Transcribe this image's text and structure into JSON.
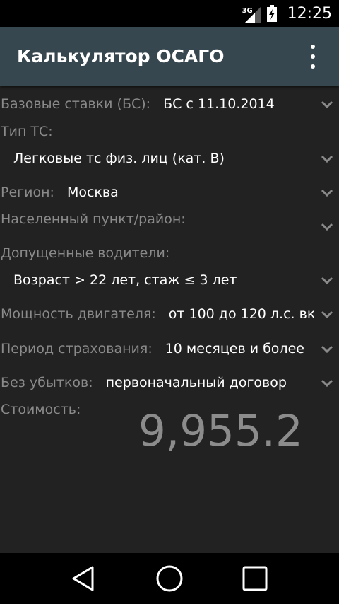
{
  "status_bar": {
    "network": "3G",
    "time": "12:25"
  },
  "app_bar": {
    "title": "Калькулятор ОСАГО",
    "overflow_icon": "more-vert-icon"
  },
  "fields": {
    "base_rates": {
      "label": "Базовые ставки (БС):",
      "value": "БС с 11.10.2014"
    },
    "vehicle_type": {
      "label": "Тип ТС:",
      "value": "Легковые тс физ. лиц (кат. В)"
    },
    "region": {
      "label": "Регион:",
      "value": "Москва"
    },
    "locality": {
      "label": "Населенный пункт/район:",
      "value": ""
    },
    "drivers": {
      "label": "Допущенные водители:",
      "value": "Возраст > 22 лет, стаж ≤ 3 лет"
    },
    "engine_power": {
      "label": "Мощность двигателя:",
      "value": "от 100 до 120 л.с. вк"
    },
    "insurance_period": {
      "label": "Период страхования:",
      "value": "10 месяцев и более"
    },
    "no_claims": {
      "label": "Без убытков:",
      "value": "первоначальный договор"
    }
  },
  "result": {
    "label": "Стоимость:",
    "value": "9,955.2"
  },
  "colors": {
    "background": "#222222",
    "app_bar": "#37474f",
    "label_text": "#8a8a8a",
    "value_text": "#ffffff",
    "cost_text": "#8c8c8c"
  },
  "nav_bar": {
    "back_icon": "back-triangle-icon",
    "home_icon": "home-circle-icon",
    "recents_icon": "recents-square-icon"
  }
}
